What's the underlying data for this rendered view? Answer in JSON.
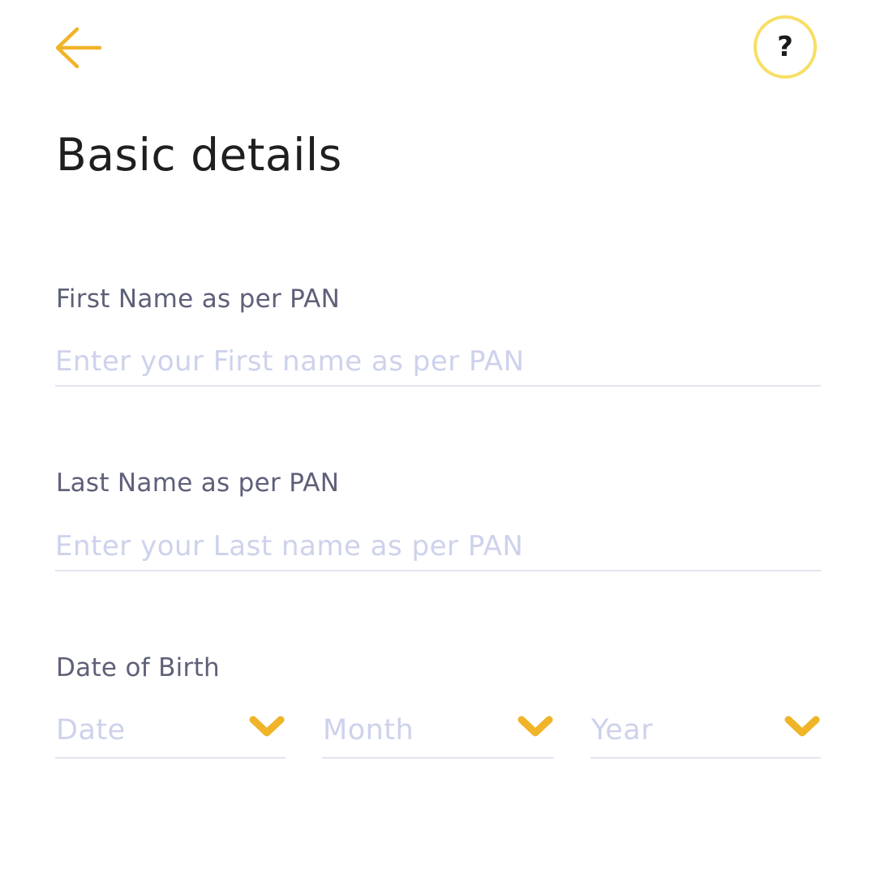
{
  "header": {
    "back_icon": "arrow-left-icon",
    "help_icon": "question-mark-icon",
    "help_symbol": "?",
    "accent_color": "#f0b429"
  },
  "page": {
    "title": "Basic details"
  },
  "form": {
    "first_name": {
      "label": "First Name as per PAN",
      "placeholder": "Enter your First name as per PAN",
      "value": ""
    },
    "last_name": {
      "label": "Last Name as per PAN",
      "placeholder": "Enter your Last name as per PAN",
      "value": ""
    },
    "dob": {
      "label": "Date of Birth",
      "date": {
        "placeholder": "Date",
        "icon": "chevron-down-icon"
      },
      "month": {
        "placeholder": "Month",
        "icon": "chevron-down-icon"
      },
      "year": {
        "placeholder": "Year",
        "icon": "chevron-down-icon"
      }
    }
  }
}
